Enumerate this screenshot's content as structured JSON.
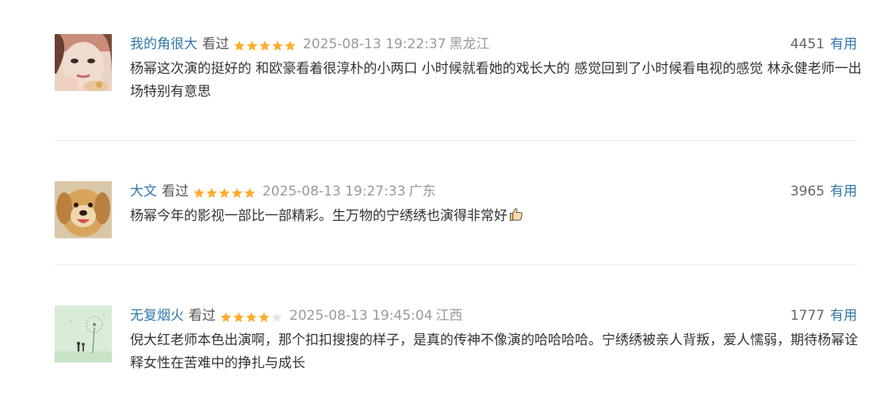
{
  "comments": [
    {
      "username": "我的角很大",
      "watched": "看过",
      "stars": 5,
      "time": "2025-08-13 19:22:37",
      "region": "黑龙江",
      "votes": "4451",
      "useful_label": "有用",
      "text": "杨幂这次演的挺好的 和欧豪看着很淳朴的小两口 小时候就看她的戏长大的 感觉回到了小时候看电视的感觉 林永健老师一出场特别有意思",
      "avatar_icon": "woman-portrait-icon"
    },
    {
      "username": "大文",
      "watched": "看过",
      "stars": 5,
      "time": "2025-08-13 19:27:33",
      "region": "广东",
      "votes": "3965",
      "useful_label": "有用",
      "text": "杨幂今年的影视一部比一部精彩。生万物的宁绣绣也演得非常好",
      "emoji_icon": "thumbs-up-icon",
      "avatar_icon": "golden-retriever-icon"
    },
    {
      "username": "无复烟火",
      "watched": "看过",
      "stars": 4,
      "time": "2025-08-13 19:45:04",
      "region": "江西",
      "votes": "1777",
      "useful_label": "有用",
      "text": "倪大红老师本色出演啊，那个扣扣搜搜的样子，是真的传神不像演的哈哈哈哈。宁绣绣被亲人背叛，爱人懦弱，期待杨幂诠释女性在苦难中的挣扎与成长",
      "avatar_icon": "dandelion-couple-icon"
    }
  ],
  "colors": {
    "link": "#3377aa",
    "star_filled": "#ffac2d",
    "star_empty": "#e5e5e5",
    "meta_gray": "#999999",
    "divider": "#e9e9e9"
  }
}
